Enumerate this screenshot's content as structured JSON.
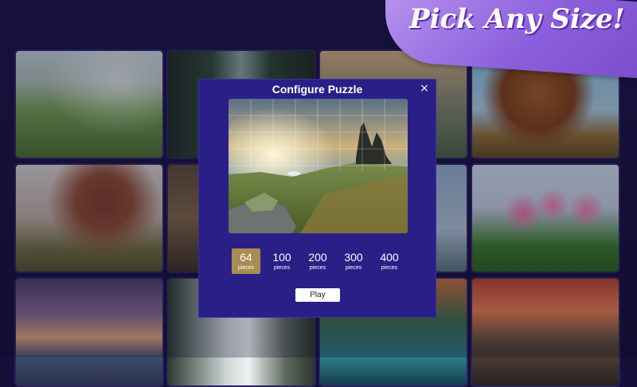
{
  "banner": {
    "text": "Pick  Any Size!"
  },
  "gallery": {
    "tiles": [
      {
        "subject": "green meadow hills"
      },
      {
        "subject": "pine forest path"
      },
      {
        "subject": "mountain peaks"
      },
      {
        "subject": "autumn oak tree"
      },
      {
        "subject": "misty autumn tree"
      },
      {
        "subject": "foggy woods"
      },
      {
        "subject": "palm beach"
      },
      {
        "subject": "pink tulips"
      },
      {
        "subject": "sunset seashore"
      },
      {
        "subject": "waterfall"
      },
      {
        "subject": "mountain lake"
      },
      {
        "subject": "dusk mountains"
      }
    ]
  },
  "dialog": {
    "title": "Configure Puzzle",
    "close_icon": "×",
    "sizes": [
      {
        "value": "64",
        "label": "pieces",
        "selected": true
      },
      {
        "value": "100",
        "label": "pieces",
        "selected": false
      },
      {
        "value": "200",
        "label": "pieces",
        "selected": false
      },
      {
        "value": "300",
        "label": "pieces",
        "selected": false
      },
      {
        "value": "400",
        "label": "pieces",
        "selected": false
      }
    ],
    "play_label": "Play"
  },
  "colors": {
    "background": "#15103a",
    "dialog": "#2a1f86",
    "selected_size": "#a98c52",
    "banner": "#8b5fdc"
  }
}
